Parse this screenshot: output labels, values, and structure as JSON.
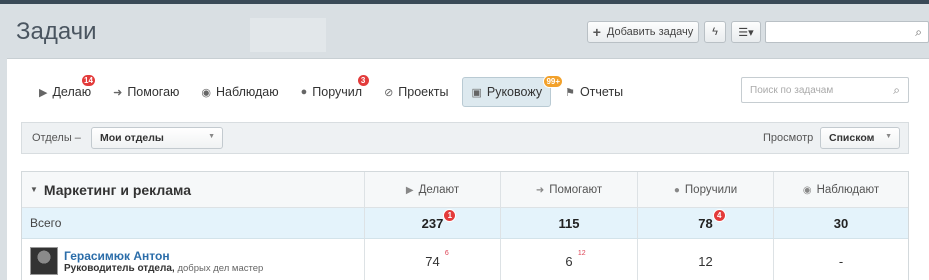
{
  "header": {
    "title": "Задачи",
    "add_task_label": "Добавить задачу",
    "flash_icon": "flash-icon",
    "filter_icon": "list-filter-icon",
    "search_value": "",
    "search_icon": "search-icon"
  },
  "tabs": [
    {
      "label": "Делаю",
      "icon": "play-icon",
      "badge": "14"
    },
    {
      "label": "Помогаю",
      "icon": "arrow-right-icon",
      "badge": ""
    },
    {
      "label": "Наблюдаю",
      "icon": "eye-icon",
      "badge": ""
    },
    {
      "label": "Поручил",
      "icon": "person-icon",
      "badge": "3"
    },
    {
      "label": "Проекты",
      "icon": "compass-icon",
      "badge": ""
    },
    {
      "label": "Руковожу",
      "icon": "contact-card-icon",
      "badge": "99+",
      "active": true
    },
    {
      "label": "Отчеты",
      "icon": "flag-icon",
      "badge": ""
    }
  ],
  "task_search": {
    "placeholder": "Поиск по задачам"
  },
  "filter": {
    "departments_label": "Отделы –",
    "departments_value": "Мои отделы",
    "view_label": "Просмотр",
    "view_value": "Списком"
  },
  "grid": {
    "group_title": "Маркетинг и реклама",
    "columns": [
      "Делают",
      "Помогают",
      "Поручили",
      "Наблюдают"
    ],
    "total": {
      "label": "Всего",
      "doing": "237",
      "doing_badge": "1",
      "helping": "115",
      "assigned": "78",
      "assigned_badge": "4",
      "watching": "30"
    },
    "people": [
      {
        "name": "Герасимюк Антон",
        "role": "Руководитель отдела,",
        "motto": "добрых дел мастер",
        "doing": "74",
        "doing_sup": "6",
        "helping": "6",
        "helping_sup": "12",
        "assigned": "12",
        "watching": "-"
      }
    ]
  },
  "colors": {
    "badge_red": "#e33b3b",
    "badge_orange": "#f2a12b",
    "active_tab_bg": "#dde9ef",
    "total_row_bg": "#e4f3fb",
    "link": "#2b6da9"
  }
}
